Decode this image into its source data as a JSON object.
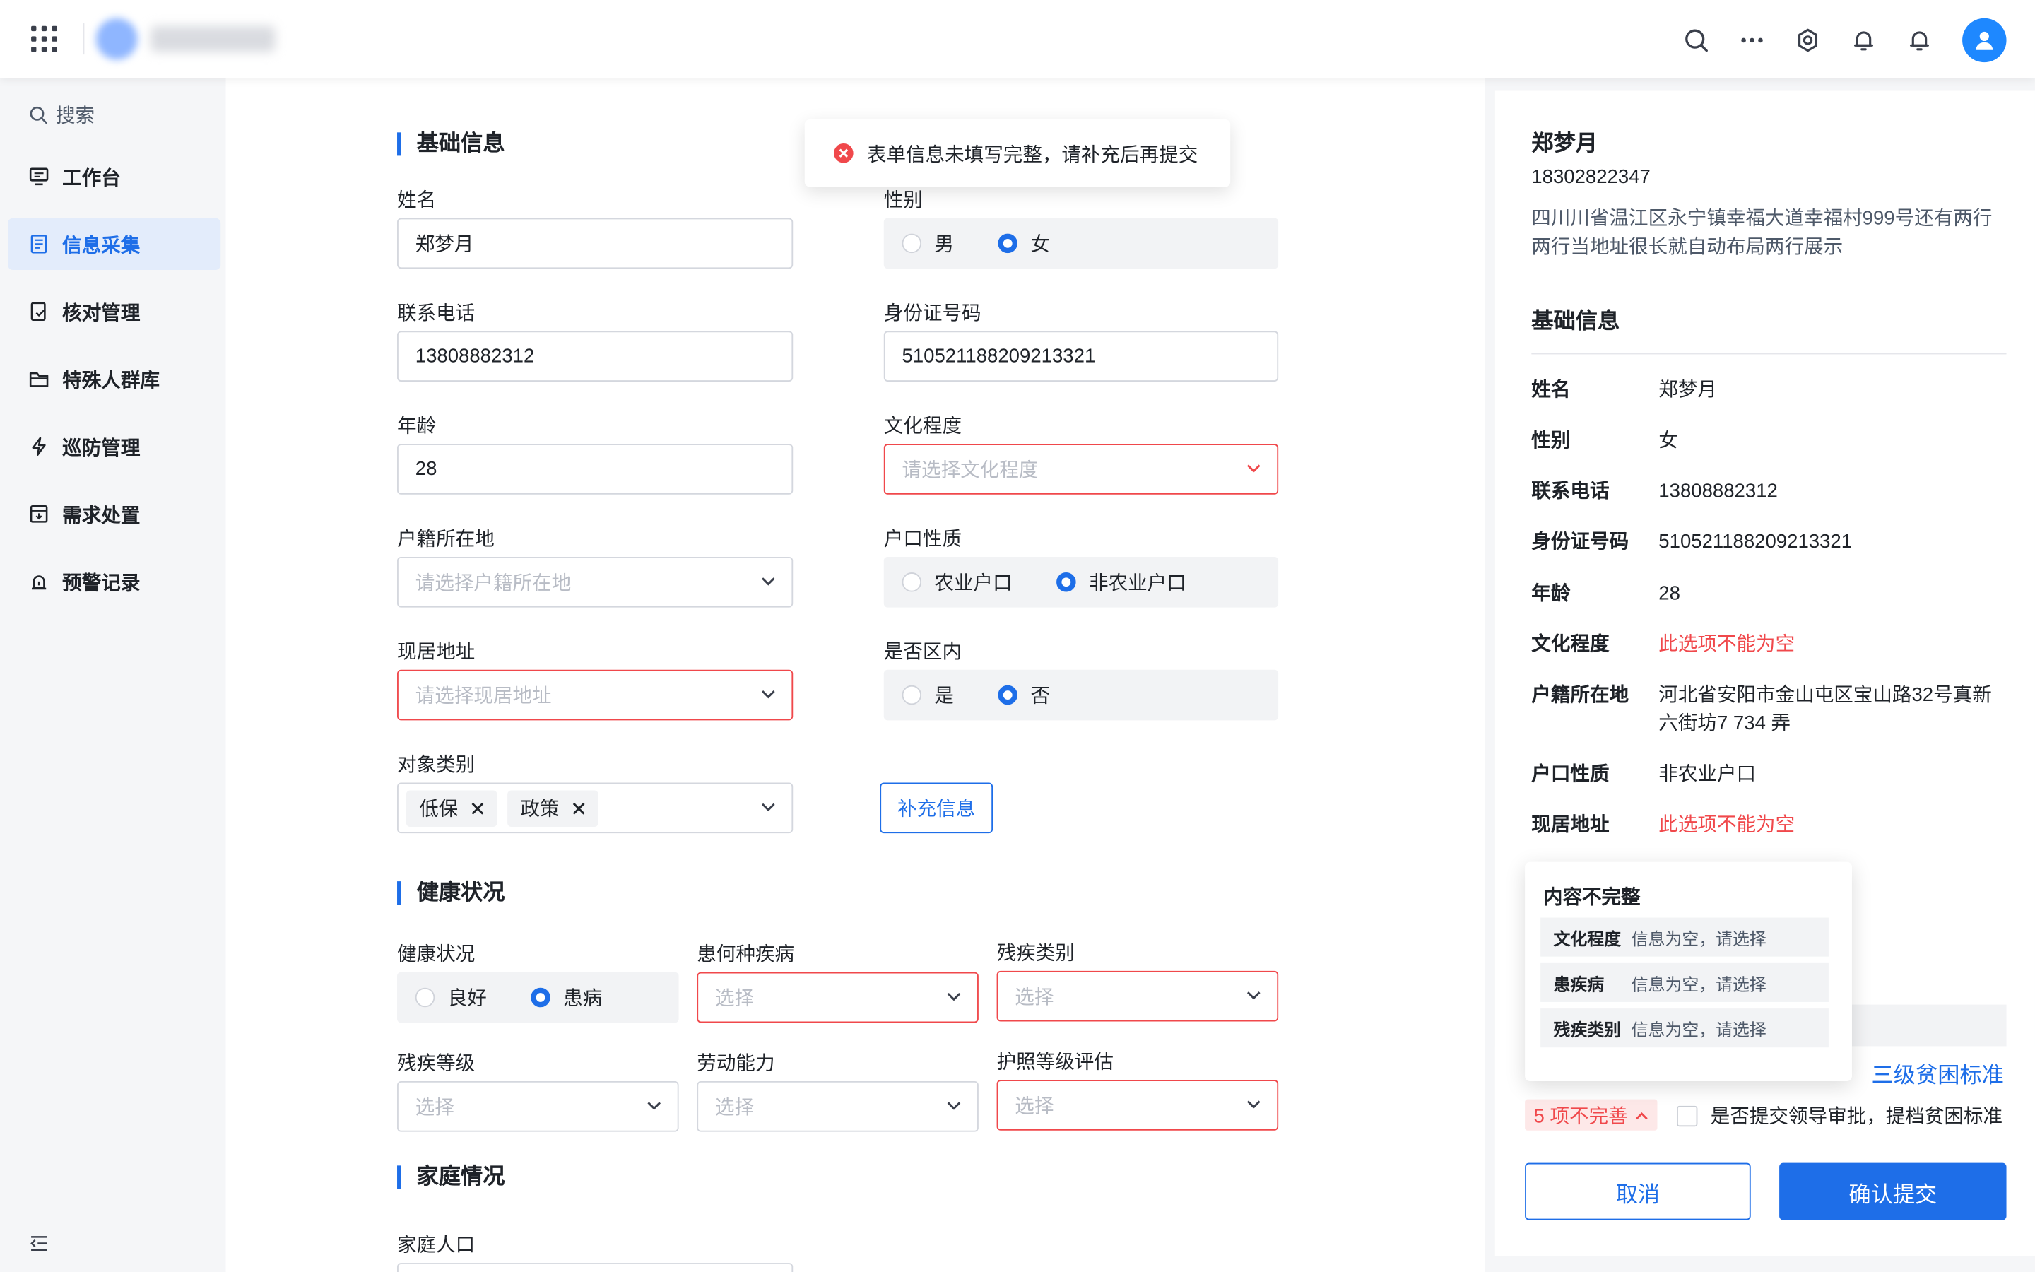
{
  "topbar": {
    "icons": [
      "apps-grid-icon",
      "search-icon",
      "more-icon",
      "settings-icon",
      "bell-icon",
      "notification-icon",
      "user-avatar"
    ]
  },
  "sidebar": {
    "search_label": "搜索",
    "items": [
      {
        "label": "工作台",
        "icon": "monitor-icon"
      },
      {
        "label": "信息采集",
        "icon": "form-icon",
        "active": true
      },
      {
        "label": "核对管理",
        "icon": "check-doc-icon"
      },
      {
        "label": "特殊人群库",
        "icon": "folder-icon"
      },
      {
        "label": "巡防管理",
        "icon": "lightning-icon"
      },
      {
        "label": "需求处置",
        "icon": "inbox-icon"
      },
      {
        "label": "预警记录",
        "icon": "alarm-icon"
      }
    ]
  },
  "toast": {
    "message": "表单信息未填写完整，请补充后再提交"
  },
  "form": {
    "basic_title": "基础信息",
    "name_label": "姓名",
    "name_value": "郑梦月",
    "gender_label": "性别",
    "gender_options": [
      "男",
      "女"
    ],
    "phone_label": "联系电话",
    "phone_value": "13808882312",
    "id_label": "身份证号码",
    "id_value": "510521188209213321",
    "age_label": "年龄",
    "age_value": "28",
    "education_label": "文化程度",
    "education_placeholder": "请选择文化程度",
    "hukou_label": "户籍所在地",
    "hukou_placeholder": "请选择户籍所在地",
    "hukou_type_label": "户口性质",
    "hukou_type_options": [
      "农业户口",
      "非农业户口"
    ],
    "address_label": "现居地址",
    "address_placeholder": "请选择现居地址",
    "in_district_label": "是否区内",
    "in_district_options": [
      "是",
      "否"
    ],
    "category_label": "对象类别",
    "category_tags": [
      "低保",
      "政策"
    ],
    "supplement_button": "补充信息",
    "health_title": "健康状况",
    "health_label": "健康状况",
    "health_options": [
      "良好",
      "患病"
    ],
    "disease_label": "患何种疾病",
    "disease_placeholder": "选择",
    "disability_type_label": "残疾类别",
    "disability_type_placeholder": "选择",
    "disability_level_label": "残疾等级",
    "disability_level_placeholder": "选择",
    "labor_label": "劳动能力",
    "labor_placeholder": "选择",
    "care_level_label": "护照等级评估",
    "care_level_placeholder": "选择",
    "family_title": "家庭情况",
    "family_size_label": "家庭人口"
  },
  "preview": {
    "name": "郑梦月",
    "phone": "18302822347",
    "address": "四川川省温江区永宁镇幸福大道幸福村999号还有两行两行当地址很长就自动布局两行展示",
    "section": "基础信息",
    "rows": [
      {
        "key": "姓名",
        "value": "郑梦月"
      },
      {
        "key": "性别",
        "value": "女"
      },
      {
        "key": "联系电话",
        "value": "13808882312"
      },
      {
        "key": "身份证号码",
        "value": "510521188209213321"
      },
      {
        "key": "年龄",
        "value": "28"
      },
      {
        "key": "文化程度",
        "value": "此选项不能为空",
        "error": true
      },
      {
        "key": "户籍所在地",
        "value": "河北省安阳市金山屯区宝山路32号真新六街坊7 734 弄"
      },
      {
        "key": "户口性质",
        "value": "非农业户口"
      },
      {
        "key": "现居地址",
        "value": "此选项不能为空",
        "error": true
      }
    ],
    "level_link": "三级贫困标准",
    "incomplete_badge": "5 项不完善",
    "submit_check_label": "是否提交领导审批，提档贫困标准",
    "cancel": "取消",
    "confirm": "确认提交"
  },
  "popover": {
    "title": "内容不完整",
    "items": [
      {
        "key": "文化程度",
        "value": "信息为空，请选择"
      },
      {
        "key": "患疾病",
        "value": "信息为空，请选择"
      },
      {
        "key": "残疾类别",
        "value": "信息为空，请选择"
      }
    ]
  },
  "colors": {
    "primary": "#1e6ee8",
    "error": "#f0484b"
  }
}
